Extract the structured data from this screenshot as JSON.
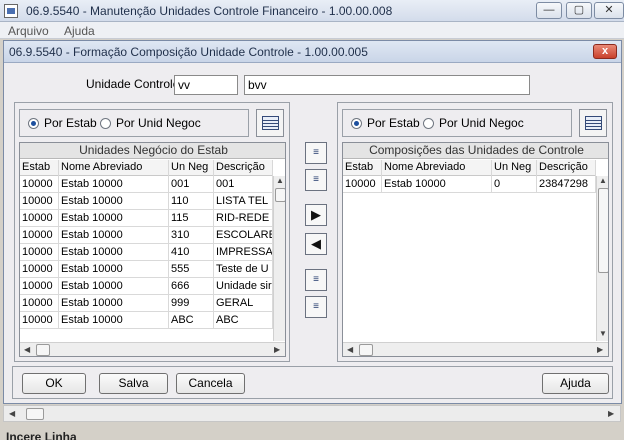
{
  "window": {
    "title": "06.9.5540 - Manutenção Unidades Controle Financeiro - 1.00.00.008",
    "minimize": "—",
    "maximize": "▢",
    "close": "✕"
  },
  "menu": {
    "items": [
      "Arquivo",
      "Ajuda"
    ]
  },
  "dialog": {
    "title": "06.9.5540 - Formação Composição Unidade Controle - 1.00.00.005",
    "close": "x"
  },
  "unidade": {
    "label": "Unidade Controle:",
    "code": "vv",
    "description": "bvv"
  },
  "left_panel": {
    "radio_estab": "Por Estab",
    "radio_unid": "Por Unid Negoc",
    "selected": "Por Estab",
    "grid_title": "Unidades Negócio do Estab",
    "columns": [
      "Estab",
      "Nome Abreviado",
      "Un Neg",
      "Descrição"
    ],
    "rows": [
      [
        "10000",
        "Estab 10000",
        "001",
        "001"
      ],
      [
        "10000",
        "Estab 10000",
        "110",
        "LISTA TEL"
      ],
      [
        "10000",
        "Estab 10000",
        "115",
        "RID-REDE"
      ],
      [
        "10000",
        "Estab 10000",
        "310",
        "ESCOLARE"
      ],
      [
        "10000",
        "Estab 10000",
        "410",
        "IMPRESSA"
      ],
      [
        "10000",
        "Estab 10000",
        "555",
        "Teste de U"
      ],
      [
        "10000",
        "Estab 10000",
        "666",
        "Unidade sir"
      ],
      [
        "10000",
        "Estab 10000",
        "999",
        "GERAL"
      ],
      [
        "10000",
        "Estab 10000",
        "ABC",
        "ABC"
      ]
    ]
  },
  "right_panel": {
    "radio_estab": "Por Estab",
    "radio_unid": "Por Unid Negoc",
    "selected": "Por Estab",
    "grid_title": "Composições das Unidades de Controle",
    "columns": [
      "Estab",
      "Nome Abreviado",
      "Un Neg",
      "Descrição"
    ],
    "rows": [
      [
        "10000",
        "Estab 10000",
        "0",
        "23847298"
      ]
    ]
  },
  "move_buttons": {
    "add_all": "≡",
    "add_some": "≡",
    "add": "▶",
    "remove": "◀",
    "remove_all": "≡",
    "remove_some": "≡"
  },
  "buttons": {
    "ok": "OK",
    "save": "Salva",
    "cancel": "Cancela",
    "help": "Ajuda"
  },
  "status": "Incere Linha"
}
